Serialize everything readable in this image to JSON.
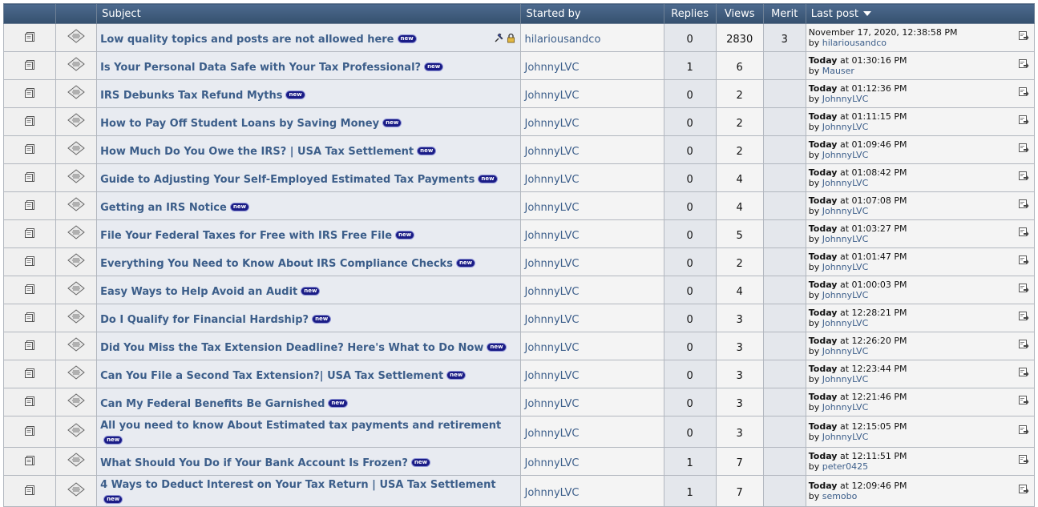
{
  "header": {
    "subject": "Subject",
    "started_by": "Started by",
    "replies": "Replies",
    "views": "Views",
    "merit": "Merit",
    "last_post": "Last post"
  },
  "icons": {
    "topic": "document-icon",
    "type": "message-diamond-icon",
    "new": "new-badge-icon",
    "pin": "pin-icon",
    "lock": "lock-icon",
    "go_to_last": "go-to-last-post-icon",
    "sort": "sort-desc-icon"
  },
  "colors": {
    "header_bg": "#3f5a7c",
    "link": "#3c5e8a",
    "new_badge": "#1a1c86"
  },
  "new_label": "new",
  "by_label": "by",
  "topics": [
    {
      "subject": "Low quality topics and posts are not allowed here",
      "starter": "hilariousandco",
      "replies": "0",
      "views": "2830",
      "merit": "3",
      "last_date_bold": "",
      "last_date": "November 17, 2020, 12:38:58 PM",
      "last_by": "hilariousandco",
      "pinned": true
    },
    {
      "subject": "Is Your Personal Data Safe with Your Tax Professional?",
      "starter": "JohnnyLVC",
      "replies": "1",
      "views": "6",
      "merit": "",
      "last_date_bold": "Today",
      "last_date": " at 01:30:16 PM",
      "last_by": "Mauser"
    },
    {
      "subject": "IRS Debunks Tax Refund Myths",
      "starter": "JohnnyLVC",
      "replies": "0",
      "views": "2",
      "merit": "",
      "last_date_bold": "Today",
      "last_date": " at 01:12:36 PM",
      "last_by": "JohnnyLVC"
    },
    {
      "subject": "How to Pay Off Student Loans by Saving Money",
      "starter": "JohnnyLVC",
      "replies": "0",
      "views": "2",
      "merit": "",
      "last_date_bold": "Today",
      "last_date": " at 01:11:15 PM",
      "last_by": "JohnnyLVC"
    },
    {
      "subject": "How Much Do You Owe the IRS? | USA Tax Settlement",
      "starter": "JohnnyLVC",
      "replies": "0",
      "views": "2",
      "merit": "",
      "last_date_bold": "Today",
      "last_date": " at 01:09:46 PM",
      "last_by": "JohnnyLVC"
    },
    {
      "subject": "Guide to Adjusting Your Self-Employed Estimated Tax Payments",
      "starter": "JohnnyLVC",
      "replies": "0",
      "views": "4",
      "merit": "",
      "last_date_bold": "Today",
      "last_date": " at 01:08:42 PM",
      "last_by": "JohnnyLVC"
    },
    {
      "subject": "Getting an IRS Notice",
      "starter": "JohnnyLVC",
      "replies": "0",
      "views": "4",
      "merit": "",
      "last_date_bold": "Today",
      "last_date": " at 01:07:08 PM",
      "last_by": "JohnnyLVC"
    },
    {
      "subject": "File Your Federal Taxes for Free with IRS Free File",
      "starter": "JohnnyLVC",
      "replies": "0",
      "views": "5",
      "merit": "",
      "last_date_bold": "Today",
      "last_date": " at 01:03:27 PM",
      "last_by": "JohnnyLVC"
    },
    {
      "subject": "Everything You Need to Know About IRS Compliance Checks",
      "starter": "JohnnyLVC",
      "replies": "0",
      "views": "2",
      "merit": "",
      "last_date_bold": "Today",
      "last_date": " at 01:01:47 PM",
      "last_by": "JohnnyLVC"
    },
    {
      "subject": "Easy Ways to Help Avoid an Audit",
      "starter": "JohnnyLVC",
      "replies": "0",
      "views": "4",
      "merit": "",
      "last_date_bold": "Today",
      "last_date": " at 01:00:03 PM",
      "last_by": "JohnnyLVC"
    },
    {
      "subject": "Do I Qualify for Financial Hardship?",
      "starter": "JohnnyLVC",
      "replies": "0",
      "views": "3",
      "merit": "",
      "last_date_bold": "Today",
      "last_date": " at 12:28:21 PM",
      "last_by": "JohnnyLVC"
    },
    {
      "subject": "Did You Miss the Tax Extension Deadline? Here's What to Do Now",
      "starter": "JohnnyLVC",
      "replies": "0",
      "views": "3",
      "merit": "",
      "last_date_bold": "Today",
      "last_date": " at 12:26:20 PM",
      "last_by": "JohnnyLVC"
    },
    {
      "subject": "Can You File a Second Tax Extension?| USA Tax Settlement",
      "starter": "JohnnyLVC",
      "replies": "0",
      "views": "3",
      "merit": "",
      "last_date_bold": "Today",
      "last_date": " at 12:23:44 PM",
      "last_by": "JohnnyLVC"
    },
    {
      "subject": "Can My Federal Benefits Be Garnished",
      "starter": "JohnnyLVC",
      "replies": "0",
      "views": "3",
      "merit": "",
      "last_date_bold": "Today",
      "last_date": " at 12:21:46 PM",
      "last_by": "JohnnyLVC"
    },
    {
      "subject": "All you need to know About Estimated tax payments and retirement",
      "starter": "JohnnyLVC",
      "replies": "0",
      "views": "3",
      "merit": "",
      "last_date_bold": "Today",
      "last_date": " at 12:15:05 PM",
      "last_by": "JohnnyLVC"
    },
    {
      "subject": "What Should You Do if Your Bank Account Is Frozen?",
      "starter": "JohnnyLVC",
      "replies": "1",
      "views": "7",
      "merit": "",
      "last_date_bold": "Today",
      "last_date": " at 12:11:51 PM",
      "last_by": "peter0425"
    },
    {
      "subject": "4 Ways to Deduct Interest on Your Tax Return | USA Tax Settlement",
      "starter": "JohnnyLVC",
      "replies": "1",
      "views": "7",
      "merit": "",
      "last_date_bold": "Today",
      "last_date": " at 12:09:46 PM",
      "last_by": "semobo"
    }
  ]
}
